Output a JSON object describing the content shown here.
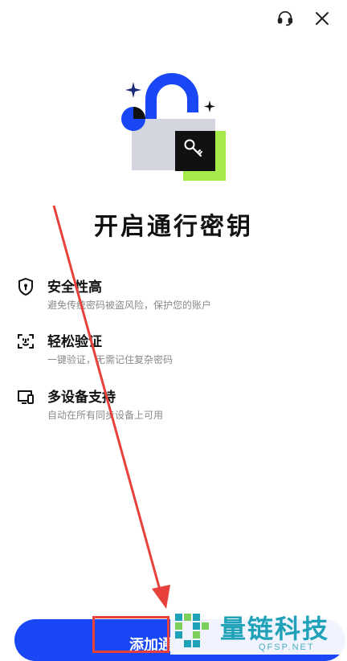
{
  "page": {
    "title": "开启通行密钥"
  },
  "topbar": {
    "icons": [
      "headset-icon",
      "close-icon"
    ]
  },
  "features": [
    {
      "icon": "shield-icon",
      "title": "安全性高",
      "desc": "避免传统密码被盗风险，保护您的账户"
    },
    {
      "icon": "face-scan-icon",
      "title": "轻松验证",
      "desc": "一键验证，无需记住复杂密码"
    },
    {
      "icon": "devices-icon",
      "title": "多设备支持",
      "desc": "自动在所有同步设备上可用"
    }
  ],
  "cta": {
    "label": "添加通"
  },
  "watermark": {
    "brand": "量链科技",
    "url": "QFSP.NET"
  },
  "colors": {
    "primary": "#1a47f5",
    "accent_green": "#a4ea4b",
    "annotation_red": "#e8413b",
    "watermark": "#1fa2b8"
  }
}
